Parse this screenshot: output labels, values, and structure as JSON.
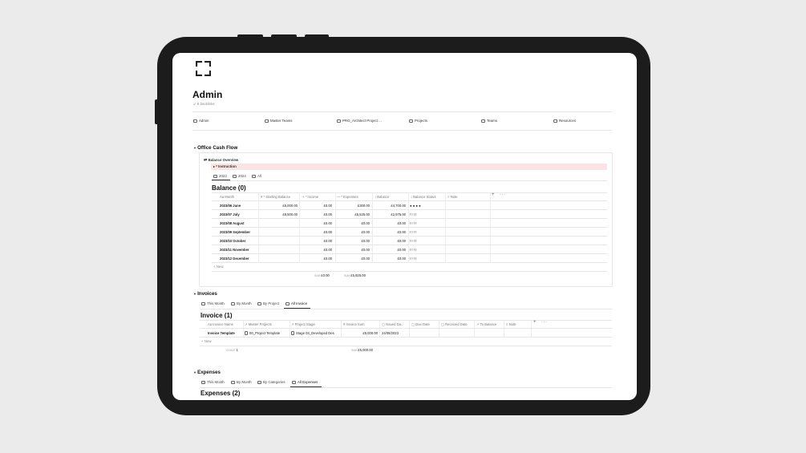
{
  "page": {
    "title": "Admin",
    "backlinks": "5 backlinks"
  },
  "nav": [
    {
      "icon": "refresh-icon",
      "label": "Admin"
    },
    {
      "icon": "people-icon",
      "label": "Master Teams"
    },
    {
      "icon": "grid-icon",
      "label": "PRO_Architect Project ..."
    },
    {
      "icon": "grid-icon",
      "label": "Projects"
    },
    {
      "icon": "teams-icon",
      "label": "Teams"
    },
    {
      "icon": "globe-icon",
      "label": "Resources"
    }
  ],
  "office_cash_flow": {
    "heading": "Office Cash Flow",
    "balance_overview": "Balance Overview",
    "instruction": "Instruction",
    "tabs": [
      "2023",
      "2024",
      "All"
    ],
    "table_title": "Balance (0)",
    "columns": [
      "Month",
      "* Starting Balance",
      "* Income",
      "* Expenses",
      "Balance",
      "Balance Status",
      "Note"
    ],
    "rows": [
      {
        "month": "2023/06 June",
        "start": "£5,000.00",
        "income": "£0.00",
        "expenses": "£300.00",
        "balance": "£4,700.00",
        "status": "● ● ● ●"
      },
      {
        "month": "2023/07 July",
        "start": "£8,500.00",
        "income": "£0.00",
        "expenses": "£5,525.00",
        "balance": "£2,975.00",
        "status": "! ! ! !"
      },
      {
        "month": "2023/08 August",
        "start": "",
        "income": "£0.00",
        "expenses": "£0.00",
        "balance": "£0.00",
        "status": "! ! ! !"
      },
      {
        "month": "2023/09 September",
        "start": "",
        "income": "£0.00",
        "expenses": "£0.00",
        "balance": "£0.00",
        "status": "! ! ! !"
      },
      {
        "month": "2023/10 October",
        "start": "",
        "income": "£0.00",
        "expenses": "£0.00",
        "balance": "£0.00",
        "status": "! ! ! !"
      },
      {
        "month": "2023/11 November",
        "start": "",
        "income": "£0.00",
        "expenses": "£0.00",
        "balance": "£0.00",
        "status": "! ! ! !"
      },
      {
        "month": "2023/12 December",
        "start": "",
        "income": "£0.00",
        "expenses": "£0.00",
        "balance": "£0.00",
        "status": "! ! ! !"
      }
    ],
    "new_label": "New",
    "sum_label": "SUM",
    "sum_income": "£0.00",
    "sum_expenses": "£5,825.00"
  },
  "invoices": {
    "heading": "Invoices",
    "tabs": [
      "This Month",
      "By Month",
      "By Project",
      "All Invoice"
    ],
    "table_title": "Invoice (1)",
    "columns": [
      "Invoice Name",
      "Master Projects",
      "Project Stage",
      "Invoice Sum",
      "Issued Da...",
      "Due Date",
      "Received Date",
      "To Balance",
      "Note"
    ],
    "row": {
      "name": "Invoice Template",
      "master": "00_Project Template",
      "stage": "Stage 03_Developed Des",
      "sum": "£5,000.00",
      "issued": "24/08/2023"
    },
    "new_label": "New",
    "count_label": "COUNT",
    "count": "1",
    "sum_label": "SUM",
    "sum_total": "£5,000.00"
  },
  "expenses": {
    "heading": "Expenses",
    "tabs": [
      "This Month",
      "By Month",
      "By Categories",
      "All Expenses"
    ],
    "table_title": "Expenses (2)"
  }
}
